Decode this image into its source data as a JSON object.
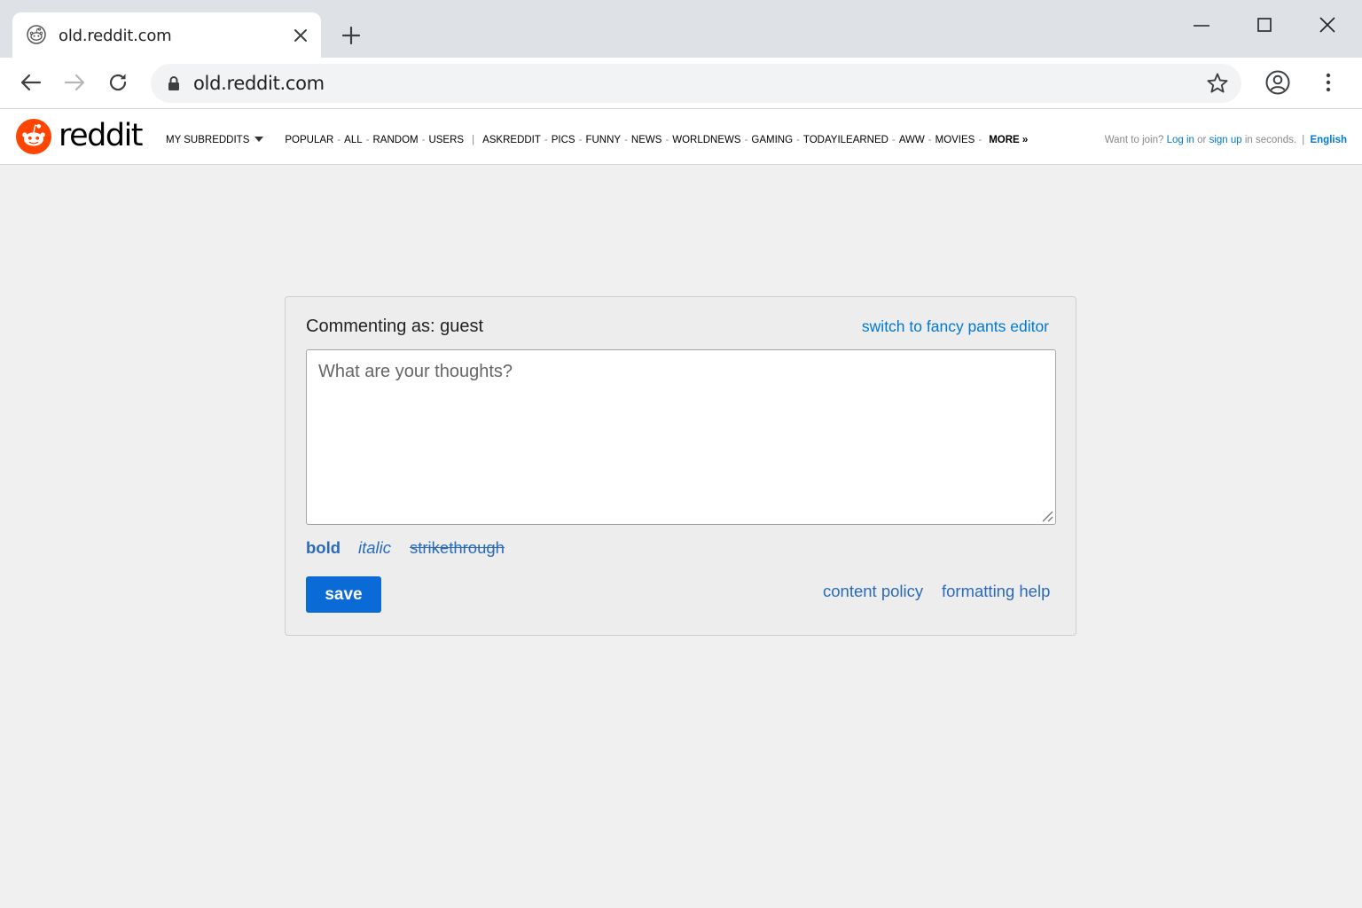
{
  "browser": {
    "tab_title": "old.reddit.com",
    "url": "old.reddit.com"
  },
  "reddit": {
    "wordmark": "reddit",
    "my_subreddits": "MY SUBREDDITS",
    "primary_links": [
      "POPULAR",
      "ALL",
      "RANDOM",
      "USERS"
    ],
    "subreddits": [
      "ASKREDDIT",
      "PICS",
      "FUNNY",
      "NEWS",
      "WORLDNEWS",
      "GAMING",
      "TODAYILEARNED",
      "AWW",
      "MOVIES"
    ],
    "more": "MORE »",
    "user_bar": {
      "want_to_join": "Want to join?",
      "log_in": "Log in",
      "or": "or",
      "sign_up": "sign up",
      "in_seconds": "in seconds.",
      "separator": "|",
      "language": "English"
    },
    "accent_color": "#ff4500",
    "link_color": "#0079d3"
  },
  "comment_form": {
    "commenting_as": "Commenting as: guest",
    "fancy_editor_link": "switch to fancy pants editor",
    "placeholder": "What are your thoughts?",
    "value": "",
    "format_bold": "bold",
    "format_italic": "italic",
    "format_strike": "strikethrough",
    "save_label": "save",
    "content_policy": "content policy",
    "formatting_help": "formatting help"
  }
}
